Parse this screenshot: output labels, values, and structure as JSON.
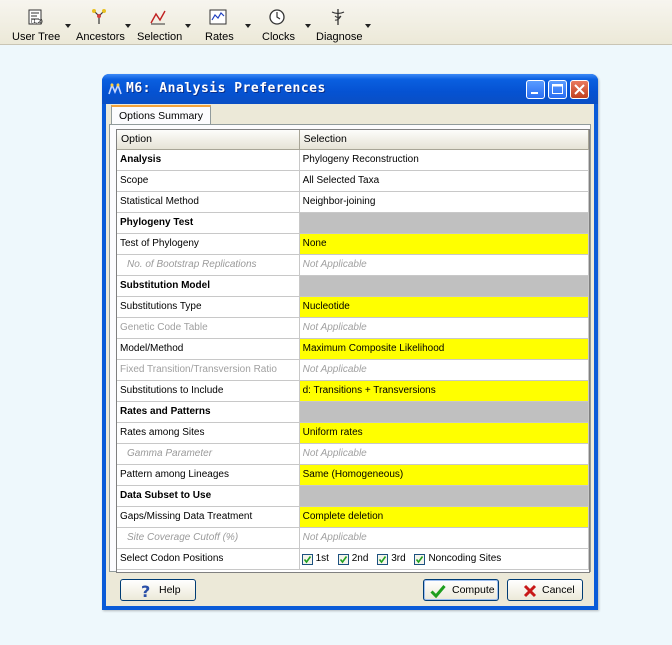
{
  "toolbar": {
    "items": [
      {
        "label": "User Tree",
        "icon": "user-tree-icon"
      },
      {
        "label": "Ancestors",
        "icon": "ancestors-icon"
      },
      {
        "label": "Selection",
        "icon": "selection-icon"
      },
      {
        "label": "Rates",
        "icon": "rates-icon"
      },
      {
        "label": "Clocks",
        "icon": "clock-icon"
      },
      {
        "label": "Diagnose",
        "icon": "diagnose-icon"
      }
    ]
  },
  "dialog": {
    "title": "M6: Analysis Preferences",
    "tab": "Options Summary",
    "columns": [
      "Option",
      "Selection"
    ],
    "rows": [
      {
        "option": "Analysis",
        "selection": "Phylogeny Reconstruction",
        "style": "header-white"
      },
      {
        "option": "Scope",
        "selection": "All Selected Taxa",
        "style": "normal"
      },
      {
        "option": "Statistical Method",
        "selection": "Neighbor-joining",
        "style": "normal"
      },
      {
        "option": "Phylogeny Test",
        "selection": "",
        "style": "section"
      },
      {
        "option": "Test of Phylogeny",
        "selection": "None",
        "style": "yellow"
      },
      {
        "option": "No. of Bootstrap Replications",
        "selection": "Not Applicable",
        "style": "disabled-indent"
      },
      {
        "option": "Substitution Model",
        "selection": "",
        "style": "section"
      },
      {
        "option": "Substitutions Type",
        "selection": "Nucleotide",
        "style": "yellow"
      },
      {
        "option": "Genetic Code Table",
        "selection": "Not Applicable",
        "style": "disabled"
      },
      {
        "option": "Model/Method",
        "selection": "Maximum Composite Likelihood",
        "style": "yellow"
      },
      {
        "option": "Fixed Transition/Transversion Ratio",
        "selection": "Not Applicable",
        "style": "disabled"
      },
      {
        "option": "Substitutions to Include",
        "selection": "d: Transitions + Transversions",
        "style": "yellow"
      },
      {
        "option": "Rates and Patterns",
        "selection": "",
        "style": "section"
      },
      {
        "option": "Rates among Sites",
        "selection": "Uniform rates",
        "style": "yellow"
      },
      {
        "option": "Gamma Parameter",
        "selection": "Not Applicable",
        "style": "disabled-indent"
      },
      {
        "option": "Pattern among Lineages",
        "selection": "Same (Homogeneous)",
        "style": "yellow"
      },
      {
        "option": "Data Subset to Use",
        "selection": "",
        "style": "section"
      },
      {
        "option": "Gaps/Missing Data Treatment",
        "selection": "Complete deletion",
        "style": "yellow"
      },
      {
        "option": "Site Coverage Cutoff (%)",
        "selection": "Not Applicable",
        "style": "disabled-indent"
      }
    ],
    "codon_row": {
      "option": "Select Codon Positions",
      "checkboxes": [
        {
          "label": "1st",
          "checked": true
        },
        {
          "label": "2nd",
          "checked": true
        },
        {
          "label": "3rd",
          "checked": true
        },
        {
          "label": "Noncoding Sites",
          "checked": true
        }
      ]
    },
    "buttons": {
      "help": "Help",
      "compute": "Compute",
      "cancel": "Cancel"
    }
  },
  "colors": {
    "highlight": "#ffff00",
    "section": "#c0c0c0",
    "titlebar": "#0552d2"
  }
}
